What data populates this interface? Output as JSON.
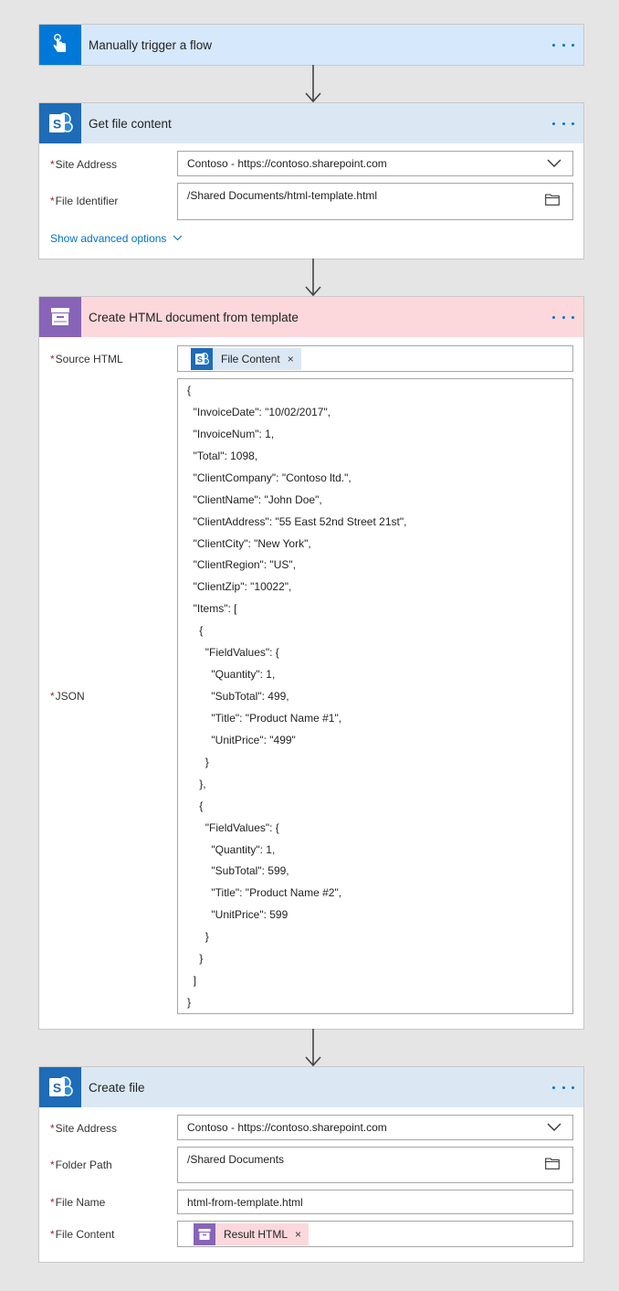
{
  "trigger": {
    "title": "Manually trigger a flow"
  },
  "get_file": {
    "title": "Get file content",
    "site_address_label": "Site Address",
    "site_address_value": "Contoso - https://contoso.sharepoint.com",
    "file_identifier_label": "File Identifier",
    "file_identifier_value": "/Shared Documents/html-template.html",
    "advanced_options": "Show advanced options"
  },
  "create_html": {
    "title": "Create HTML document from template",
    "source_html_label": "Source HTML",
    "source_token": "File Content",
    "json_label": "JSON",
    "json_lines": [
      "{",
      "  \"InvoiceDate\": \"10/02/2017\",",
      "  \"InvoiceNum\": 1,",
      "  \"Total\": 1098,",
      "  \"ClientCompany\": \"Contoso ltd.\",",
      "  \"ClientName\": \"John Doe\",",
      "  \"ClientAddress\": \"55 East 52nd Street 21st\",",
      "  \"ClientCity\": \"New York\",",
      "  \"ClientRegion\": \"US\",",
      "  \"ClientZip\": \"10022\",",
      "  \"Items\": [",
      "    {",
      "      \"FieldValues\": {",
      "        \"Quantity\": 1,",
      "        \"SubTotal\": 499,",
      "        \"Title\": \"Product Name #1\",",
      "        \"UnitPrice\": \"499\"",
      "      }",
      "    },",
      "    {",
      "      \"FieldValues\": {",
      "        \"Quantity\": 1,",
      "        \"SubTotal\": 599,",
      "        \"Title\": \"Product Name #2\",",
      "        \"UnitPrice\": 599",
      "      }",
      "    }",
      "  ]",
      "}"
    ]
  },
  "create_file": {
    "title": "Create file",
    "site_address_label": "Site Address",
    "site_address_value": "Contoso - https://contoso.sharepoint.com",
    "folder_path_label": "Folder Path",
    "folder_path_value": "/Shared Documents",
    "file_name_label": "File Name",
    "file_name_value": "html-from-template.html",
    "file_content_label": "File Content",
    "file_content_token": "Result HTML"
  },
  "icons": {
    "trigger": "hand-tap-icon",
    "sharepoint": "sharepoint-icon",
    "archive": "archive-box-icon",
    "more": "more-dots-icon",
    "chevron": "chevron-down-icon",
    "folder": "folder-icon",
    "remove": "remove-x-icon",
    "arrow": "arrow-down-icon"
  },
  "colors": {
    "background": "#e5e5e5",
    "trigger_header": "#d6e8fb",
    "trigger_icon": "#0078d7",
    "sharepoint_header": "#dbe8f4",
    "sharepoint_icon": "#036c70",
    "sharepoint_blue": "#1e6bb8",
    "html_header": "#fcd8dc",
    "html_icon": "#8764b8",
    "link": "#0072c6",
    "required": "#a4262c"
  }
}
